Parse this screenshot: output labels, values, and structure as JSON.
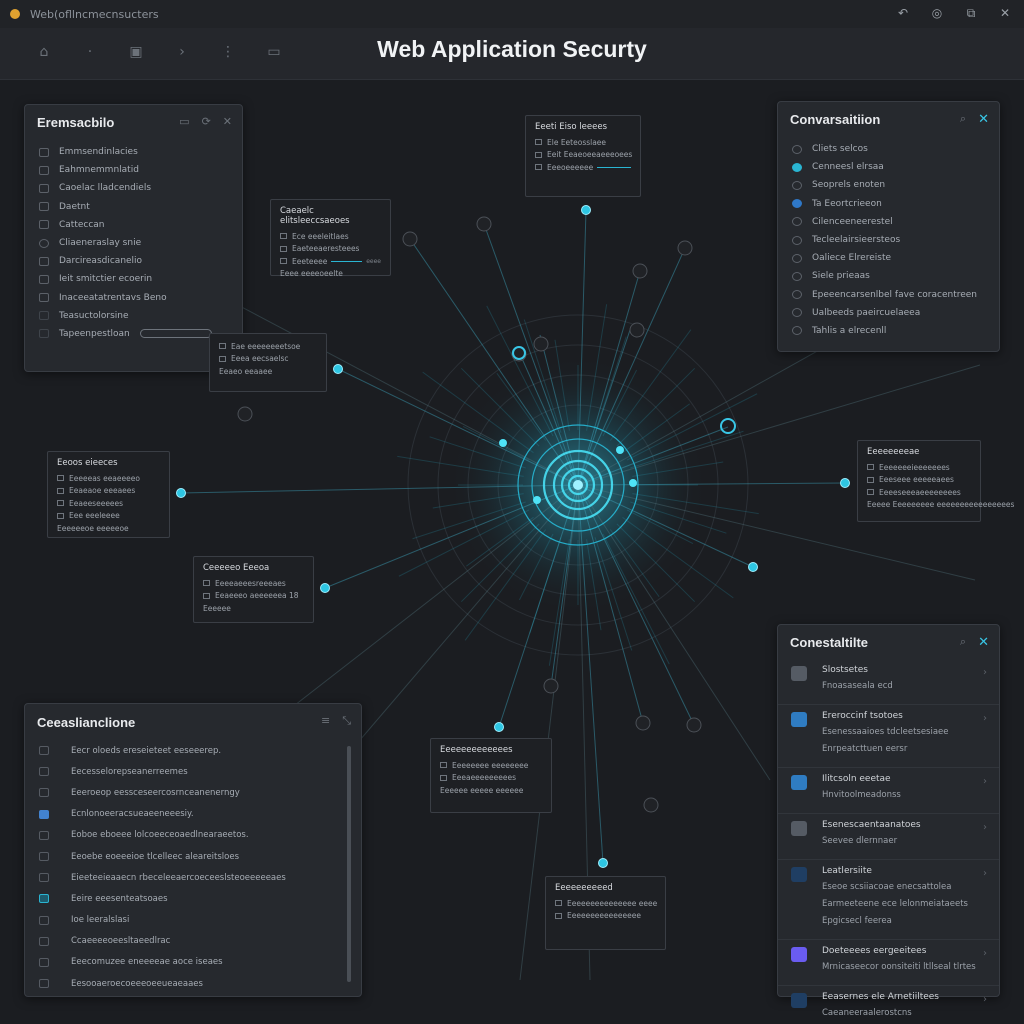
{
  "window": {
    "title": "Web(ofllncmecnsucters"
  },
  "toolbar": {
    "title": "Web Application Securty"
  },
  "colors": {
    "accent": "#39c6e6",
    "background": "#1b1d21",
    "panel": "#26292e"
  },
  "left_panel": {
    "title": "Eremsacbilo",
    "items": [
      {
        "label": "Emmsendinlacies",
        "icon": "square"
      },
      {
        "label": "Eahmnemmnlatid",
        "icon": "square"
      },
      {
        "label": "Caoelac lladcendiels",
        "icon": "square"
      },
      {
        "label": "Daetnt",
        "icon": "square"
      },
      {
        "label": "Catteccan",
        "icon": "square"
      },
      {
        "label": "Cliaeneraslay snie",
        "icon": "dot"
      },
      {
        "label": "Darcireasdicanelio",
        "icon": "square"
      },
      {
        "label": "Ieit smitctier ecoerin",
        "icon": "square"
      },
      {
        "label": "Inaceeatatrentavs Beno",
        "icon": "square"
      },
      {
        "label": "Teasuctolorsine",
        "icon": "dim"
      },
      {
        "label": "Tapeenpestloan",
        "icon": "dim"
      }
    ]
  },
  "conversation_panel": {
    "title": "Convarsaitiion",
    "items": [
      {
        "label": "Cliets selcos"
      },
      {
        "label": "Cenneesl elrsaa"
      },
      {
        "label": "Seoprels enoten"
      },
      {
        "label": "Ta Eeortcrieeon"
      },
      {
        "label": "Cilenceeneerestel"
      },
      {
        "label": "Tecleelairsieersteos"
      },
      {
        "label": "Oaliece Elrereiste"
      },
      {
        "label": "Siele prieaas"
      },
      {
        "label": "Epeeencarsenlbel fave coracentreen"
      },
      {
        "label": "Ualbeeds paeircuelaeea"
      },
      {
        "label": "Tahlis a elrecenll"
      }
    ]
  },
  "details_panel": {
    "title": "Conestaltilte",
    "items": [
      {
        "title": "Slostsetes",
        "sub": [
          "Fnoasaseala ecd"
        ],
        "icon": "gray"
      },
      {
        "title": "Ereroccinf tsotoes",
        "sub": [
          "Esenessaaioes tdcleetsesiaee",
          "Enrpeatcttuen eersr"
        ],
        "icon": "blue"
      },
      {
        "title": "Ilitcsoln eeetae",
        "sub": [
          "Hnvitoolmeadonss"
        ],
        "icon": "blue"
      },
      {
        "title": "Esenescaentaanatoes",
        "sub": [
          "Seevee dlernnaer"
        ],
        "icon": "gray"
      },
      {
        "title": "Leatlersiite",
        "sub": [
          "Eseoe scsiiacoae enecsattolea",
          "Earmeeteene ece lelonmeiataeets",
          "Epgicsecl feerea"
        ],
        "icon": "navy"
      },
      {
        "title": "Doeteeees eergeeitees",
        "sub": [
          "Mrnicaseecor oonsiteiti ltllseal tlrtes"
        ],
        "icon": "purple"
      },
      {
        "title": "Eeasernes ele Arnetiiltees",
        "sub": [
          "Caeaneeraalerostcns"
        ],
        "icon": "navy"
      }
    ]
  },
  "bottom_left_panel": {
    "title": "Ceeaslianclione",
    "items": [
      {
        "label": "Eecr oloeds ereseieteet eeseeerep.",
        "icon": "square"
      },
      {
        "label": "Eecesselorepseanerreemes",
        "icon": "square"
      },
      {
        "label": "Eeeroeop eessceseercosrnceanenerngy",
        "icon": "square"
      },
      {
        "label": "Ecnlonoeeracsueaeeneeesiy.",
        "icon": "blue"
      },
      {
        "label": "Eoboe eboeee lolcoeeceoaedlnearaeetos.",
        "icon": "square"
      },
      {
        "label": "Eeoebe eoeeeioe tlcelleec aleareitsloes",
        "icon": "square"
      },
      {
        "label": "Eieeteeieaaecn rbeceleeaercoeceeslsteoeeeeeaes",
        "icon": "square"
      },
      {
        "label": "Eeire eeesenteatsoaes",
        "icon": "cyan"
      },
      {
        "label": "Ioe leeralslasi",
        "icon": "square"
      },
      {
        "label": "Ccaeeeeoeesltaeedlrac",
        "icon": "square"
      },
      {
        "label": "Eeecomuzee eneeeeae aoce iseaes",
        "icon": "square"
      },
      {
        "label": "Eesooaeroecoeeeoeeueaeaaes",
        "icon": "square"
      }
    ]
  },
  "nodes": {
    "top": {
      "title": "Eeeti Eiso leeees",
      "lines": [
        "Ele Eeteosslaee",
        "Eeit Eeaeoeeaeeeoees",
        "Eeeoeeeeee"
      ]
    },
    "upper_left": {
      "title": "Caeaelc elitsleeccsaeoes",
      "lines": [
        "Ece eeeleitlaes",
        "Eaeteeaeresteees",
        "Eeeteeee",
        "Eeee eeeeoeelte"
      ],
      "small": "eeee"
    },
    "mid_left": {
      "title": "",
      "lines": [
        "Eae eeeeeeeetsoe",
        "Eeea eecsaelsc",
        "Eeaeo eeaaee"
      ]
    },
    "left": {
      "title": "Eeoos eieeces",
      "lines": [
        "Eeeeeas eeaeeeeo",
        "Eeaeaoe eeeaees",
        "Eeaeeseeeees",
        "Eee eeeleeee",
        "Eeeeeeoe eeeeeoe"
      ]
    },
    "lower_left": {
      "title": "Ceeeeeo Eeeoa",
      "lines": [
        "Eeeeaeeesreeeaes",
        "Eeaeeeo aeeeeeea 18",
        "Eeeeee"
      ]
    },
    "right": {
      "title": "Eeeeeeeeae",
      "lines": [
        "Eeeeeeeieeeeeees",
        "Eeeseee eeeeeaees",
        "Eeeeseeeaeeeeeeees",
        "Eeeee Eeeeeeeee eeeeeeeeeeeeeeees"
      ]
    },
    "bottom_center": {
      "title": "Eeeeeeeeeeeees",
      "lines": [
        "Eeeeeeee eeeeeeee",
        "Eeeaeeeeeeeees",
        "Eeeeee eeeee eeeeee"
      ]
    },
    "bottom": {
      "title": "Eeeeeeeeeed",
      "lines": [
        "Eeeeeeeeeeeeeee eeee",
        "Eeeeeeeeeeeeeeee"
      ]
    }
  }
}
